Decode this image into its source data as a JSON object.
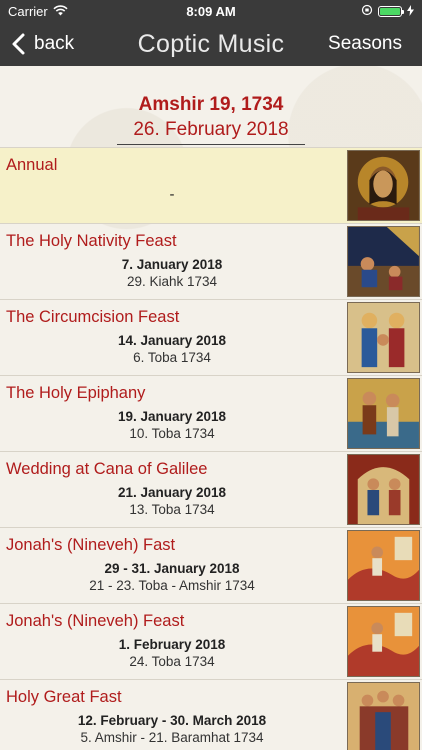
{
  "status": {
    "carrier": "Carrier",
    "time": "8:09 AM"
  },
  "nav": {
    "back_label": "back",
    "title": "Coptic Music",
    "right_label": "Seasons"
  },
  "header": {
    "coptic_date": "Amshir 19, 1734",
    "gregorian_date": "26. February 2018"
  },
  "rows": [
    {
      "title": "Annual",
      "date1": "",
      "date2": "",
      "dash": "-",
      "icon": "christ-pantocrator-icon"
    },
    {
      "title": "The Holy Nativity Feast",
      "date1": "7. January 2018",
      "date2": "29. Kiahk 1734",
      "icon": "nativity-icon"
    },
    {
      "title": "The Circumcision Feast",
      "date1": "14. January 2018",
      "date2": "6. Toba 1734",
      "icon": "circumcision-icon"
    },
    {
      "title": "The Holy Epiphany",
      "date1": "19. January 2018",
      "date2": "10. Toba 1734",
      "icon": "epiphany-icon"
    },
    {
      "title": "Wedding at Cana of Galilee",
      "date1": "21. January 2018",
      "date2": "13. Toba 1734",
      "icon": "cana-wedding-icon"
    },
    {
      "title": "Jonah's (Nineveh) Fast",
      "date1": "29 - 31. January 2018",
      "date2": "21 - 23. Toba - Amshir 1734",
      "icon": "jonah-whale-icon"
    },
    {
      "title": "Jonah's (Nineveh) Feast",
      "date1": "1. February 2018",
      "date2": "24. Toba 1734",
      "icon": "jonah-whale-icon"
    },
    {
      "title": "Holy Great Fast",
      "date1": "12. February - 30. March 2018",
      "date2": "5. Amshir - 21. Baramhat 1734",
      "icon": "great-fast-icon"
    }
  ],
  "colors": {
    "accent_red": "#b01c1c",
    "nav_bg": "#3a3a3a",
    "highlight_row": "#f6f1c9"
  }
}
